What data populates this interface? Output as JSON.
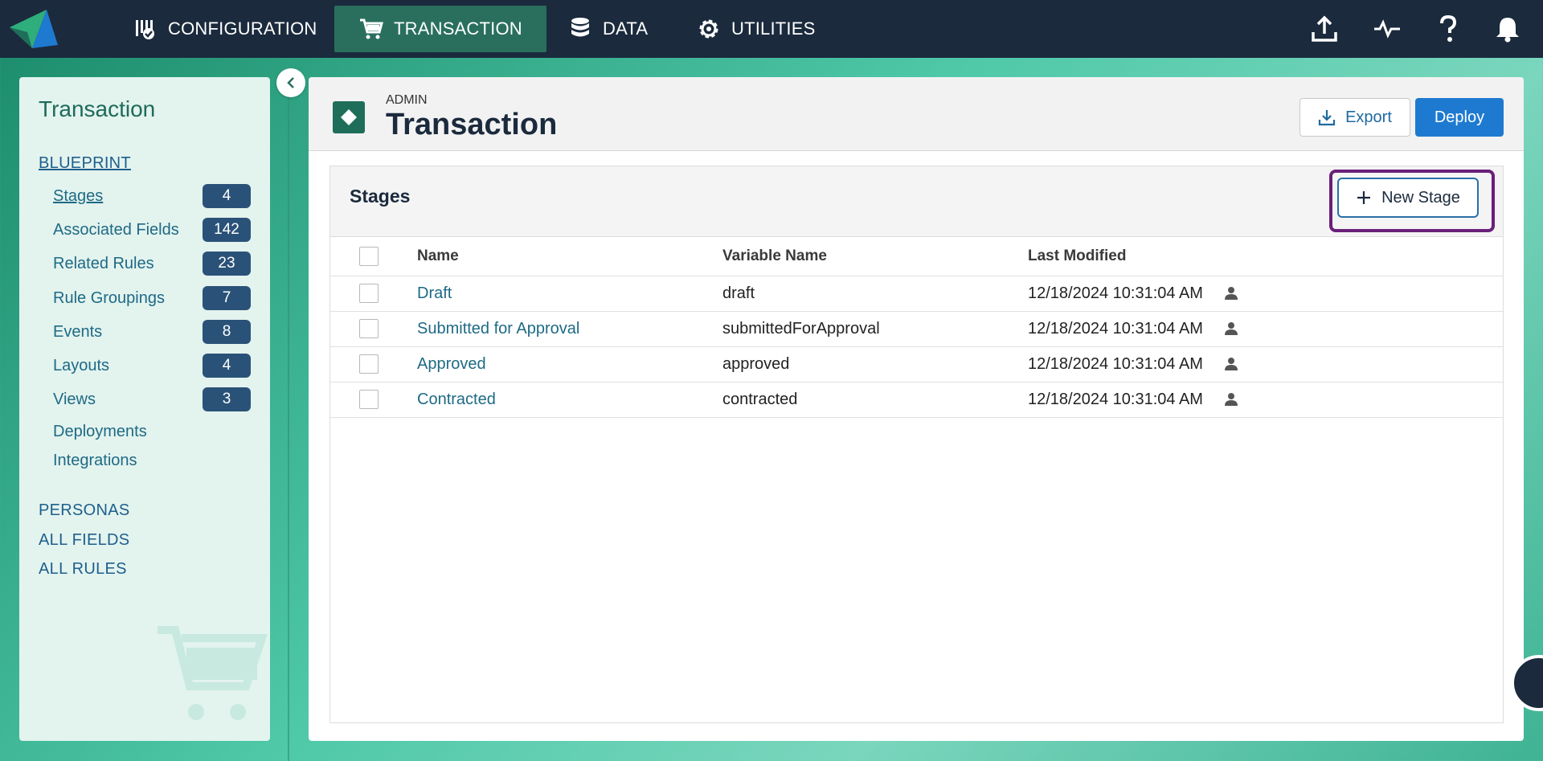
{
  "nav": {
    "items": [
      {
        "label": "CONFIGURATION",
        "icon": "checklist-icon"
      },
      {
        "label": "TRANSACTION",
        "icon": "cart-icon",
        "active": true
      },
      {
        "label": "DATA",
        "icon": "database-icon"
      },
      {
        "label": "UTILITIES",
        "icon": "gear-icon"
      }
    ],
    "right_icons": [
      "upload-icon",
      "activity-icon",
      "help-icon",
      "bell-icon"
    ]
  },
  "sidebar": {
    "title": "Transaction",
    "section_blueprint": "BLUEPRINT",
    "items": [
      {
        "label": "Stages",
        "count": "4"
      },
      {
        "label": "Associated Fields",
        "count": "142"
      },
      {
        "label": "Related Rules",
        "count": "23"
      },
      {
        "label": "Rule Groupings",
        "count": "7"
      },
      {
        "label": "Events",
        "count": "8"
      },
      {
        "label": "Layouts",
        "count": "4"
      },
      {
        "label": "Views",
        "count": "3"
      },
      {
        "label": "Deployments"
      },
      {
        "label": "Integrations"
      }
    ],
    "sections": [
      "PERSONAS",
      "ALL FIELDS",
      "ALL RULES"
    ]
  },
  "header": {
    "eyebrow": "ADMIN",
    "title": "Transaction",
    "export_label": "Export",
    "deploy_label": "Deploy"
  },
  "stages": {
    "title": "Stages",
    "new_button": "New Stage",
    "columns": [
      "Name",
      "Variable Name",
      "Last Modified"
    ],
    "rows": [
      {
        "name": "Draft",
        "variable": "draft",
        "modified": "12/18/2024 10:31:04 AM"
      },
      {
        "name": "Submitted for Approval",
        "variable": "submittedForApproval",
        "modified": "12/18/2024 10:31:04 AM"
      },
      {
        "name": "Approved",
        "variable": "approved",
        "modified": "12/18/2024 10:31:04 AM"
      },
      {
        "name": "Contracted",
        "variable": "contracted",
        "modified": "12/18/2024 10:31:04 AM"
      }
    ]
  },
  "colors": {
    "nav_bg": "#1b2a3d",
    "active_tab": "#2a6f5e",
    "badge": "#2a5278",
    "primary": "#1e7ad0",
    "highlight": "#6a1f7a"
  }
}
